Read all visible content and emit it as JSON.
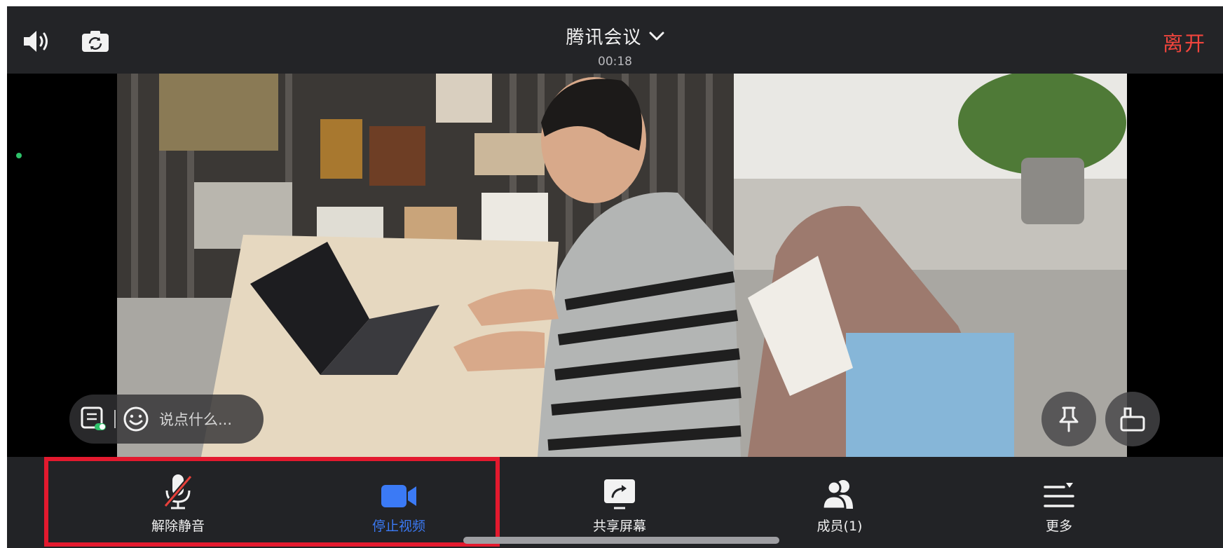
{
  "topbar": {
    "title": "腾讯会议",
    "timer": "00:18",
    "leave_label": "离开",
    "icons": [
      "speaker-icon",
      "camera-flip-icon",
      "chevron-down-icon"
    ]
  },
  "chat": {
    "placeholder": "说点什么..."
  },
  "toolbar": {
    "items": [
      {
        "label": "解除静音",
        "icon": "mic-muted-icon"
      },
      {
        "label": "停止视频",
        "icon": "video-camera-icon",
        "active": true
      },
      {
        "label": "共享屏幕",
        "icon": "share-screen-icon"
      },
      {
        "label": "成员(1)",
        "icon": "members-icon"
      },
      {
        "label": "更多",
        "icon": "more-menu-icon"
      }
    ]
  },
  "colors": {
    "background": "#222326",
    "leave": "#f2453d",
    "active": "#3b7af5",
    "highlight": "#e3192e"
  }
}
